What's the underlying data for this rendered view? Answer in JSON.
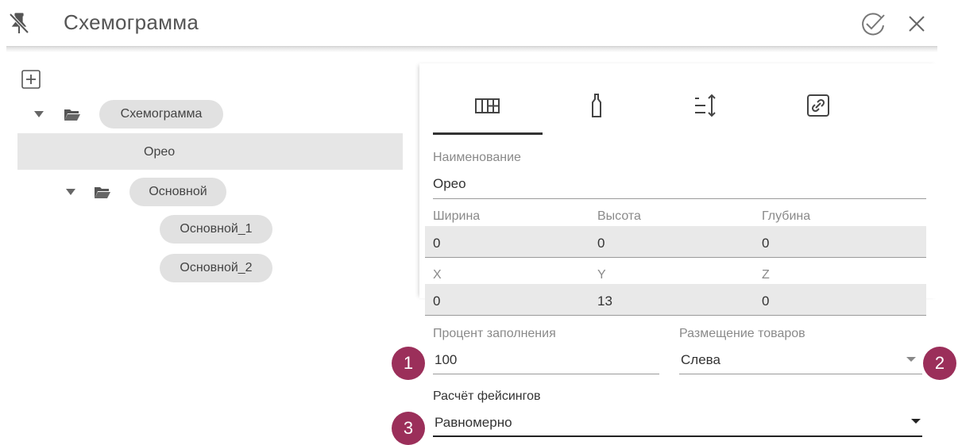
{
  "header": {
    "title": "Схемограмма"
  },
  "tree": {
    "root": {
      "label": "Схемограмма"
    },
    "selected_item": {
      "label": "Орео"
    },
    "group": {
      "label": "Основной"
    },
    "children": [
      {
        "label": "Основной_1"
      },
      {
        "label": "Основной_2"
      }
    ]
  },
  "tabs": [
    {
      "icon": "grid-icon"
    },
    {
      "icon": "bottle-icon"
    },
    {
      "icon": "sort-height-icon"
    },
    {
      "icon": "link-icon"
    }
  ],
  "form": {
    "name": {
      "label": "Наименование",
      "value": "Орео"
    },
    "dimensions": {
      "width": {
        "label": "Ширина",
        "value": "0"
      },
      "height": {
        "label": "Высота",
        "value": "0"
      },
      "depth": {
        "label": "Глубина",
        "value": "0"
      }
    },
    "position": {
      "x": {
        "label": "X",
        "value": "0"
      },
      "y": {
        "label": "Y",
        "value": "13"
      },
      "z": {
        "label": "Z",
        "value": "0"
      }
    },
    "fill_percent": {
      "label": "Процент заполнения",
      "value": "100"
    },
    "placement": {
      "label": "Размещение товаров",
      "value": "Слева"
    },
    "facings": {
      "label": "Расчёт фейсингов",
      "value": "Равномерно"
    }
  },
  "callouts": [
    "1",
    "2",
    "3"
  ],
  "colors": {
    "callout": "#9b2f5a",
    "chip": "#e1e1e1",
    "selected_row": "#e6e6e6"
  }
}
